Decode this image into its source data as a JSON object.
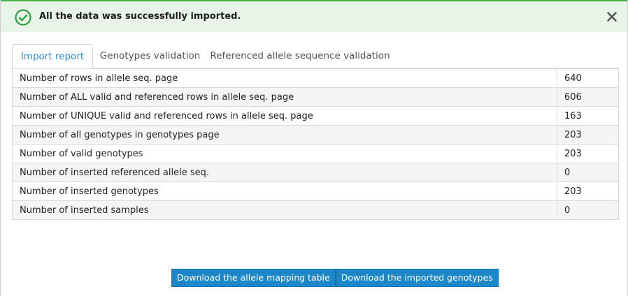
{
  "alert": {
    "message": "All the data was successfully imported.",
    "status_color": "#4cae4c",
    "icon": "check-circle-icon",
    "close_icon": "close-icon"
  },
  "tabs": [
    {
      "label": "Import report",
      "active": true
    },
    {
      "label": "Genotypes validation",
      "active": false
    },
    {
      "label": "Referenced allele sequence validation",
      "active": false
    }
  ],
  "report": {
    "rows": [
      {
        "label": "Number of rows in allele seq. page",
        "value": "640"
      },
      {
        "label": "Number of ALL valid and referenced rows in allele seq. page",
        "value": "606"
      },
      {
        "label": "Number of UNIQUE valid and referenced rows in allele seq. page",
        "value": "163"
      },
      {
        "label": "Number of all genotypes in genotypes page",
        "value": "203"
      },
      {
        "label": "Number of valid genotypes",
        "value": "203"
      },
      {
        "label": "Number of inserted referenced allele seq.",
        "value": "0"
      },
      {
        "label": "Number of inserted genotypes",
        "value": "203"
      },
      {
        "label": "Number of inserted samples",
        "value": "0"
      }
    ]
  },
  "actions": {
    "download_mapping_label": "Download the allele mapping table",
    "download_genotypes_label": "Download the imported genotypes",
    "accent_color": "#1c88c9"
  }
}
